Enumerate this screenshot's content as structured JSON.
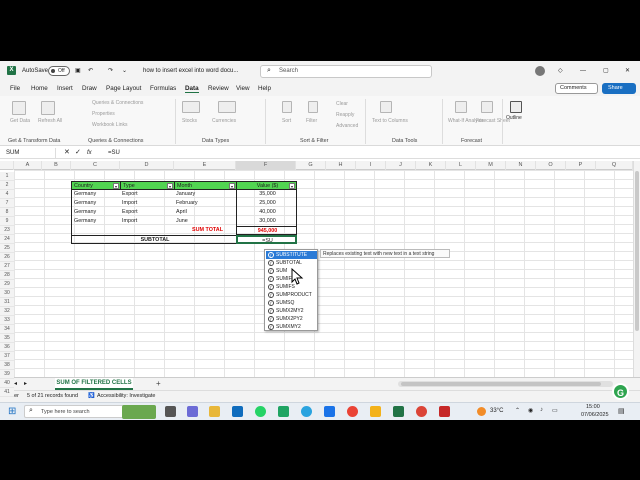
{
  "titlebar": {
    "autosave_label": "AutoSave",
    "autosave_state": "Off",
    "doc_title": "how to insert excel into word docu...",
    "search_placeholder": "Search"
  },
  "menu": [
    "File",
    "Home",
    "Insert",
    "Draw",
    "Page Layout",
    "Formulas",
    "Data",
    "Review",
    "View",
    "Help"
  ],
  "active_menu": "Data",
  "comments_label": "Comments",
  "share_label": "Share",
  "ribbon": {
    "groups": [
      "Get & Transform Data",
      "Queries & Connections",
      "Data Types",
      "Sort & Filter",
      "Data Tools",
      "Forecast"
    ],
    "items": {
      "get_data": "Get Data",
      "refresh_all": "Refresh All",
      "queries": "Queries & Connections",
      "properties": "Properties",
      "workbook_links": "Workbook Links",
      "stocks": "Stocks",
      "currencies": "Currencies",
      "sort": "Sort",
      "filter": "Filter",
      "clear": "Clear",
      "reapply": "Reapply",
      "advanced": "Advanced",
      "text_to_columns": "Text to Columns",
      "what_if": "What-If Analysis",
      "forecast_sheet": "Forecast Sheet",
      "outline": "Outline"
    }
  },
  "formula_bar": {
    "name_box": "SUM",
    "fx": "fx",
    "formula": "=SU"
  },
  "columns": [
    "A",
    "B",
    "C",
    "D",
    "E",
    "F",
    "G",
    "H",
    "I",
    "J",
    "K",
    "L",
    "M",
    "N",
    "O",
    "P",
    "Q"
  ],
  "row_numbers": [
    "1",
    "2",
    "4",
    "7",
    "8",
    "9",
    "23",
    "24",
    "25",
    "26",
    "27",
    "28",
    "29",
    "30",
    "31",
    "32",
    "33",
    "34",
    "35",
    "36",
    "37",
    "38",
    "39",
    "40",
    "41"
  ],
  "table": {
    "headers": [
      "Country",
      "Type",
      "Month",
      "Value ($)"
    ],
    "rows": [
      [
        "Germany",
        "Export",
        "January",
        "35,000"
      ],
      [
        "Germany",
        "Import",
        "February",
        "25,000"
      ],
      [
        "Germany",
        "Export",
        "April",
        "40,000"
      ],
      [
        "Germany",
        "Import",
        "June",
        "30,000"
      ]
    ],
    "sum_total_label": "SUM TOTAL",
    "sum_total_value": "945,000",
    "subtotal_label": "SUBTOTAL",
    "editing_value": "=SU"
  },
  "autocomplete": {
    "items": [
      "SUBSTITUTE",
      "SUBTOTAL",
      "SUM",
      "SUMIF",
      "SUMIFS",
      "SUMPRODUCT",
      "SUMSQ",
      "SUMX2MY2",
      "SUMX2PY2",
      "SUMXMY2"
    ],
    "selected": "SUBSTITUTE",
    "tooltip": "Replaces existing text with new text in a text string"
  },
  "sheet_tab": "SUM OF FILTERED CELLS",
  "status": {
    "mode": "Enter",
    "records": "5 of 21 records found",
    "accessibility": "Accessibility: Investigate"
  },
  "taskbar": {
    "search_placeholder": "Type here to search",
    "weather": "33°C",
    "time": "15:00",
    "date": "07/06/2025"
  },
  "colors": {
    "header_green": "#52d452",
    "sum_red": "#e00000",
    "excel_green": "#217346",
    "select_blue": "#2a7ad6"
  }
}
